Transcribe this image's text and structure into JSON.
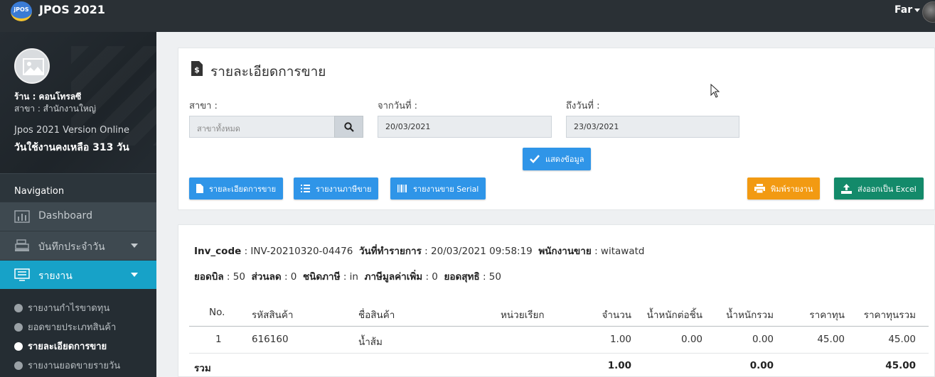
{
  "topbar": {
    "logo_text": "jPOS",
    "app_name": "JPOS 2021",
    "user_name": "Far"
  },
  "sidebar": {
    "shop_label": "ร้าน : คอนโทรลซี",
    "branch_label": "สาขา : สำนักงานใหญ่",
    "version": "Jpos 2021 Version Online",
    "days_left": "วันใช้งานคงเหลือ 313 วัน",
    "nav_header": "Navigation",
    "items": [
      {
        "label": "Dashboard"
      },
      {
        "label": "บันทึกประจำวัน"
      },
      {
        "label": "รายงาน"
      }
    ],
    "sub_items": [
      {
        "label": "รายงานกำไรขาดทุน"
      },
      {
        "label": "ยอดขายประเภทสินค้า"
      },
      {
        "label": "รายละเอียดการขาย"
      },
      {
        "label": "รายงานยอดขายรายวัน"
      }
    ]
  },
  "filter": {
    "title": "รายละเอียดการขาย",
    "branch_label": "สาขา :",
    "branch_placeholder": "สาขาทั้งหมด",
    "from_label": "จากวันที่ :",
    "from_value": "20/03/2021",
    "to_label": "ถึงวันที่ :",
    "to_value": "23/03/2021",
    "show_button": "แสดงข้อมูล",
    "btn_sale_detail": "รายละเอียดการขาย",
    "btn_tax_report": "รายงานภาษีขาย",
    "btn_serial_report": "รายงานขาย Serial",
    "btn_print": "พิมพ์รายงาน",
    "btn_export": "ส่งออกเป็น Excel"
  },
  "invoice": {
    "inv_code_label": "Inv_code",
    "inv_code": "INV-20210320-04476",
    "date_label": "วันที่ทำรายการ",
    "date": "20/03/2021 09:58:19",
    "staff_label": "พนักงานขาย",
    "staff": "witawatd",
    "bill_total_label": "ยอดบิล",
    "bill_total": "50",
    "discount_label": "ส่วนลด",
    "discount": "0",
    "tax_type_label": "ชนิดภาษี",
    "tax_type": "in",
    "vat_label": "ภาษีมูลค่าเพิ่ม",
    "vat": "0",
    "net_label": "ยอดสุทธิ",
    "net": "50"
  },
  "table": {
    "headers": [
      "No.",
      "รหัสสินค้า",
      "ชื่อสินค้า",
      "หน่วยเรียก",
      "จำนวน",
      "น้ำหนักต่อชิ้น",
      "น้ำหนักรวม",
      "ราคาทุน",
      "ราคาทุนรวม"
    ],
    "rows": [
      [
        "1",
        "616160",
        "น้ำส้ม",
        "",
        "1.00",
        "0.00",
        "0.00",
        "45.00",
        "45.00"
      ]
    ],
    "footer": {
      "label": "รวม",
      "qty": "1.00",
      "weight_total": "0.00",
      "cost_total": "45.00"
    }
  }
}
